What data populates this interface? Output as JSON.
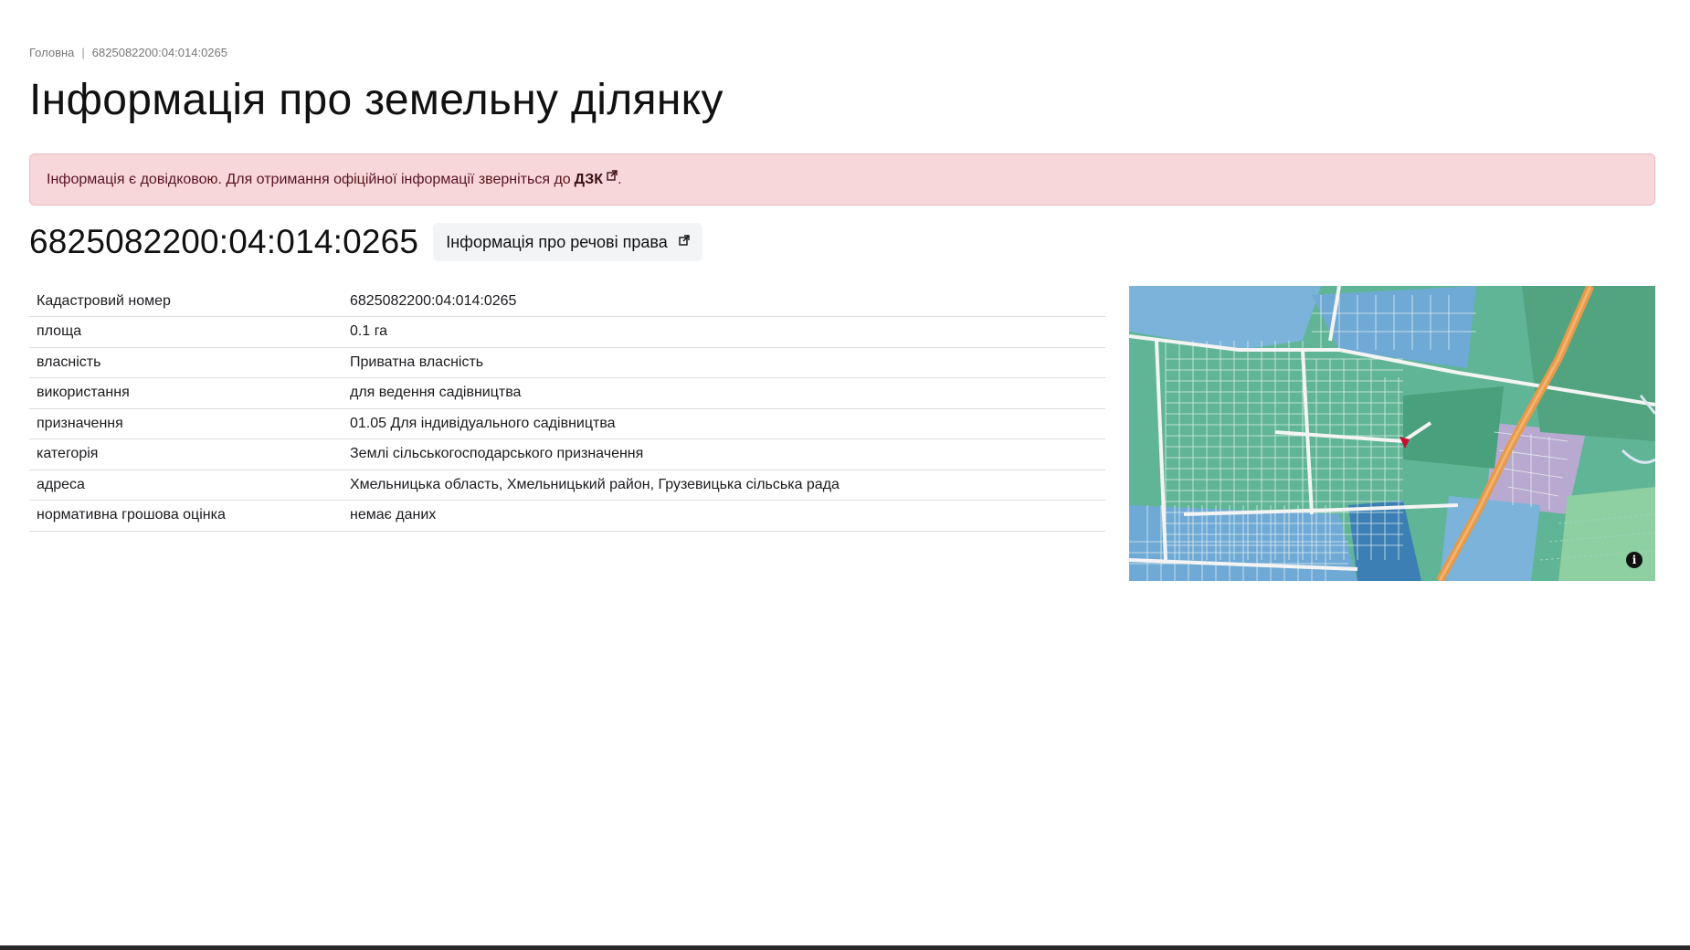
{
  "breadcrumb": {
    "home": "Головна",
    "separator": "|",
    "current": "6825082200:04:014:0265"
  },
  "page_title": "Інформація про земельну ділянку",
  "alert": {
    "text": "Інформація є довідковою. Для отримання офіційної інформації зверніться до",
    "link_label": "ДЗК",
    "end": "."
  },
  "cadastral_number": "6825082200:04:014:0265",
  "rights_button": "Інформація про речові права",
  "rows": [
    {
      "key": "Кадастровий номер",
      "value": "6825082200:04:014:0265"
    },
    {
      "key": "площа",
      "value": "0.1 га"
    },
    {
      "key": "власність",
      "value": "Приватна власність"
    },
    {
      "key": "використання",
      "value": "для ведення садівництва"
    },
    {
      "key": "призначення",
      "value": "01.05 Для індивідуального садівництва"
    },
    {
      "key": "категорія",
      "value": "Землі сільськогосподарського призначення"
    },
    {
      "key": "адреса",
      "value": "Хмельницька область, Хмельницький район, Грузевицька сільська рада"
    },
    {
      "key": "нормативна грошова оцінка",
      "value": "немає даних"
    }
  ],
  "map": {
    "info_icon": "info-icon",
    "info_glyph": "i"
  },
  "colors": {
    "alert_bg": "#f8d7da",
    "parcel_green": "#5fb596",
    "parcel_blue": "#6fa9d6",
    "road_orange": "#e59a4b",
    "selected_parcel": "#c8102e"
  }
}
